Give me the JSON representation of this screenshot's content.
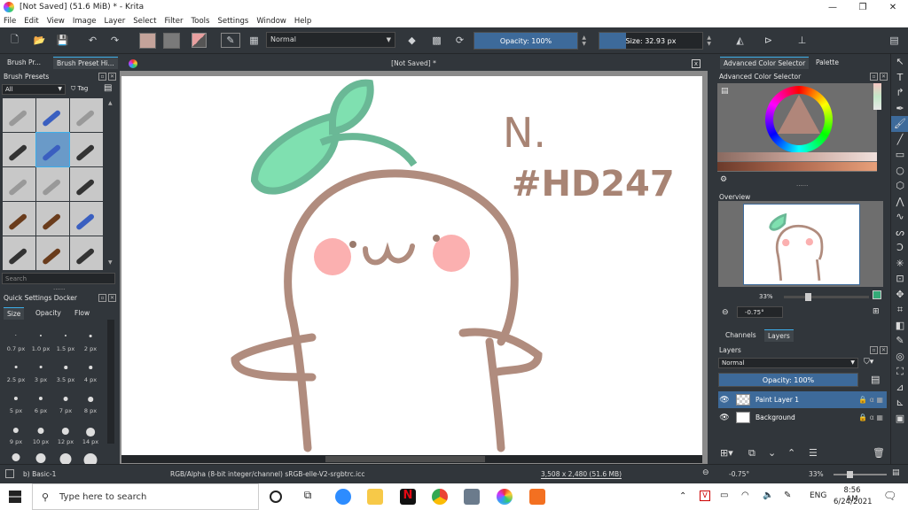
{
  "window": {
    "title": "[Not Saved]  (51.6 MiB)  * - Krita",
    "min": "—",
    "max": "❐",
    "close": "✕"
  },
  "menu": [
    "File",
    "Edit",
    "View",
    "Image",
    "Layer",
    "Select",
    "Filter",
    "Tools",
    "Settings",
    "Window",
    "Help"
  ],
  "toolbar": {
    "blend_mode": "Normal",
    "opacity": "Opacity: 100%",
    "opacity_fraction": 1.0,
    "size": "Size: 32.93 px",
    "size_fraction": 0.26,
    "fg_color": "#c4a39a",
    "bg_color": "#7a7a7a"
  },
  "brush_presets": {
    "tab1": "Brush Pr...",
    "tab2": "Brush Preset Hi...",
    "title": "Brush Presets",
    "filter": "All",
    "tag": "Tag",
    "search": "Search"
  },
  "quick_settings": {
    "title": "Quick Settings Docker",
    "tabs": [
      "Size",
      "Opacity",
      "Flow"
    ],
    "sizes": [
      "0.7 px",
      "1.0 px",
      "1.5 px",
      "2 px",
      "2.5 px",
      "3 px",
      "3.5 px",
      "4 px",
      "5 px",
      "6 px",
      "7 px",
      "8 px",
      "9 px",
      "10 px",
      "12 px",
      "14 px"
    ]
  },
  "document": {
    "tab": "[Not Saved]  *",
    "close": "x"
  },
  "color_selector": {
    "tab1": "Advanced Color Selector",
    "tab2": "Palette",
    "title": "Advanced Color Selector"
  },
  "overview": {
    "title": "Overview",
    "zoom": "33%",
    "rotation": "-0.75°"
  },
  "layers_panel": {
    "tab1": "Channels",
    "tab2": "Layers",
    "title": "Layers",
    "blend": "Normal",
    "opacity": "Opacity:  100%",
    "layers": [
      {
        "name": "Paint Layer 1",
        "selected": true
      },
      {
        "name": "Background",
        "selected": false
      }
    ]
  },
  "status": {
    "brush": "b) Basic-1",
    "colorspace": "RGB/Alpha (8-bit integer/channel)  sRGB-elle-V2-srgbtrc.icc",
    "dims": "3,508 x 2,480 (51.6 MB)",
    "rotation": "-0.75°",
    "zoom": "33%"
  },
  "taskbar": {
    "search": "Type here to search",
    "lang": "ENG",
    "time": "8:56 AM",
    "date": "6/24/2021"
  },
  "drawing": {
    "text1": "N.",
    "text2": "#HD247"
  }
}
